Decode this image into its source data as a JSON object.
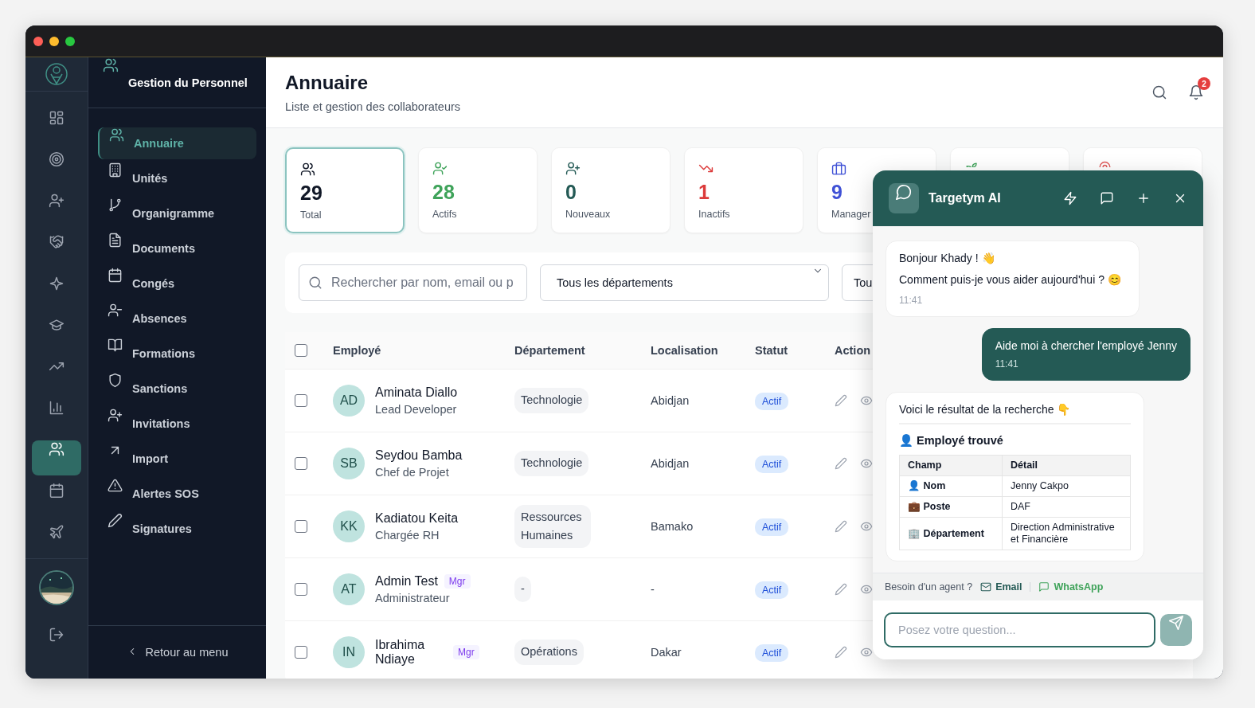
{
  "rail": {
    "items": [
      {
        "selected": false
      },
      {
        "selected": false
      },
      {
        "selected": false
      },
      {
        "selected": false
      },
      {
        "selected": false
      },
      {
        "selected": false
      },
      {
        "selected": false
      },
      {
        "selected": false
      },
      {
        "selected": true
      },
      {
        "selected": false
      },
      {
        "selected": false
      }
    ]
  },
  "sidebar": {
    "title": "Gestion du Personnel",
    "items": [
      {
        "label": "Annuaire",
        "selected": true
      },
      {
        "label": "Unités",
        "selected": false
      },
      {
        "label": "Organigramme",
        "selected": false
      },
      {
        "label": "Documents",
        "selected": false
      },
      {
        "label": "Congés",
        "selected": false
      },
      {
        "label": "Absences",
        "selected": false
      },
      {
        "label": "Formations",
        "selected": false
      },
      {
        "label": "Sanctions",
        "selected": false
      },
      {
        "label": "Invitations",
        "selected": false
      },
      {
        "label": "Import",
        "selected": false
      },
      {
        "label": "Alertes SOS",
        "selected": false
      },
      {
        "label": "Signatures",
        "selected": false
      }
    ],
    "back": "Retour au menu"
  },
  "header": {
    "title": "Annuaire",
    "subtitle": "Liste et gestion des collaborateurs",
    "notifications": "2"
  },
  "stats": [
    {
      "value": "29",
      "label": "Total",
      "color": "#111827",
      "selected": true
    },
    {
      "value": "28",
      "label": "Actifs",
      "color": "#3fa35a",
      "selected": false
    },
    {
      "value": "0",
      "label": "Nouveaux",
      "color": "#245a55",
      "selected": false
    },
    {
      "value": "1",
      "label": "Inactifs",
      "color": "#dc3b3b",
      "selected": false
    },
    {
      "value": "9",
      "label": "Manager",
      "color": "#4052d6",
      "selected": false
    },
    {
      "color": "#3fa35a",
      "selected": false
    },
    {
      "color": "#e05a5a",
      "selected": false
    }
  ],
  "filters": {
    "search": {
      "placeholder": "Rechercher par nom, email ou p"
    },
    "department": "Tous les départements",
    "status": "Tou"
  },
  "table": {
    "select_all": false,
    "columns": [
      "Employé",
      "Département",
      "Localisation",
      "Statut",
      "Action"
    ],
    "rows": [
      {
        "checked": false,
        "initials": "AD",
        "name": "Aminata Diallo",
        "role": "Lead Developer",
        "department": "Technologie",
        "location": "Abidjan",
        "status": "Actif"
      },
      {
        "checked": false,
        "initials": "SB",
        "name": "Seydou Bamba",
        "role": "Chef de Projet",
        "department": "Technologie",
        "location": "Abidjan",
        "status": "Actif"
      },
      {
        "checked": false,
        "initials": "KK",
        "name": "Kadiatou Keita",
        "role": "Chargée RH",
        "department": "Ressources Humaines",
        "location": "Bamako",
        "status": "Actif"
      },
      {
        "checked": false,
        "initials": "AT",
        "name": "Admin Test",
        "badge": "Mgr",
        "role": "Administrateur",
        "department": "-",
        "location": "-",
        "status": "Actif"
      },
      {
        "checked": false,
        "initials": "IN",
        "name": "Ibrahima Ndiaye",
        "badge": "Mgr",
        "department": "Opérations",
        "location": "Dakar",
        "status": "Actif"
      }
    ]
  },
  "chat": {
    "title": "Targetym AI",
    "messages": [
      {
        "kind": "bot",
        "lines": [
          "Bonjour Khady ! 👋",
          "Comment puis-je vous aider aujourd'hui ? 😊"
        ],
        "time": "11:41"
      },
      {
        "kind": "user",
        "lines": [
          "Aide moi à chercher l'employé Jenny"
        ],
        "time": "11:41"
      },
      {
        "kind": "result",
        "lines": [
          "Voici le résultat de la recherche 👇"
        ],
        "heading": "👤 Employé trouvé",
        "columns": [
          "Champ",
          "Détail"
        ],
        "rows": [
          [
            "👤 Nom",
            "Jenny Cakpo"
          ],
          [
            "💼 Poste",
            "DAF"
          ],
          [
            "🏢 Département",
            "Direction Administrative et Financière"
          ]
        ]
      }
    ],
    "agent": {
      "label": "Besoin d'un agent ?",
      "email": "Email",
      "whatsapp": "WhatsApp"
    },
    "input": {
      "placeholder": "Posez votre question..."
    }
  }
}
